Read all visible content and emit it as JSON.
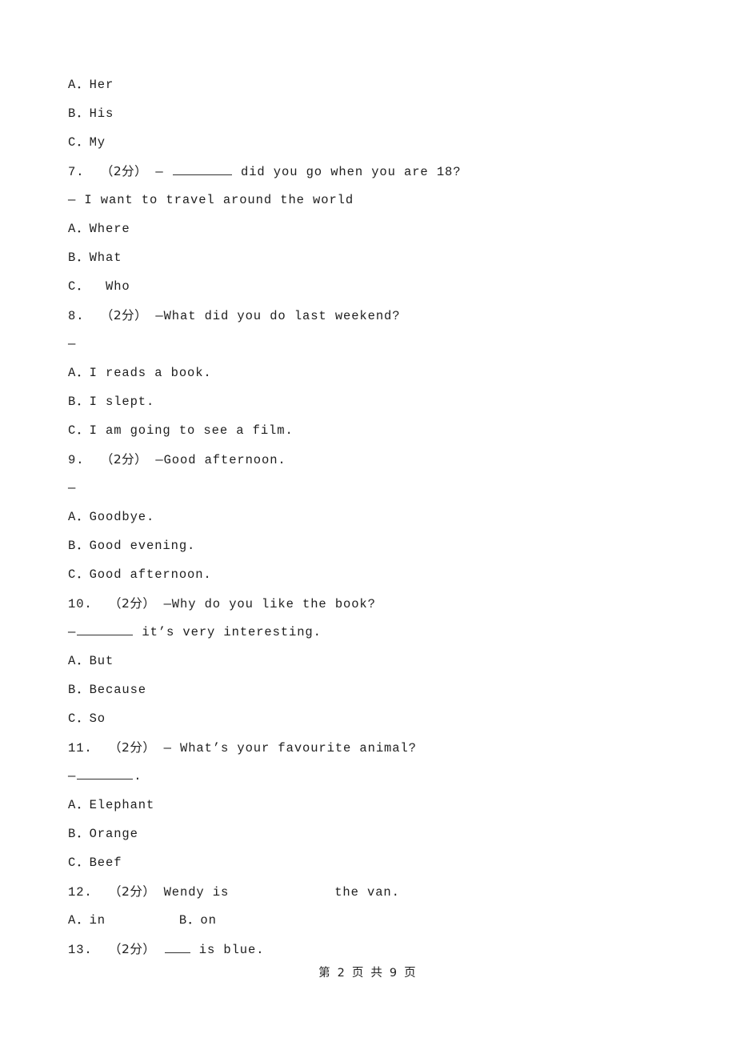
{
  "document": {
    "page_number": 2,
    "total_pages": 9,
    "footer_text": "第 2 页 共 9 页",
    "score_marker": "（2分）",
    "dash_marker": "—"
  },
  "lines": [
    {
      "id": "l1",
      "kind": "option",
      "text": "A．Her"
    },
    {
      "id": "l2",
      "kind": "option",
      "text": "B．His"
    },
    {
      "id": "l3",
      "kind": "option",
      "text": "C．My"
    },
    {
      "id": "l4",
      "kind": "stem",
      "number": "7.",
      "score": "（2分）",
      "pre": "— ",
      "post": " did you go when you are 18?",
      "blank": "long"
    },
    {
      "id": "l5",
      "kind": "answer",
      "text": "— I want to travel around the world"
    },
    {
      "id": "l6",
      "kind": "option",
      "text": "A．Where"
    },
    {
      "id": "l7",
      "kind": "option",
      "text": "B．What"
    },
    {
      "id": "l8",
      "kind": "option",
      "text": "C．  Who"
    },
    {
      "id": "l9",
      "kind": "stem",
      "number": "8.",
      "score": "（2分）",
      "pre": "—What did you do last weekend?",
      "post": "",
      "blank": "none"
    },
    {
      "id": "l10",
      "kind": "dash",
      "text": "—"
    },
    {
      "id": "l11",
      "kind": "option",
      "text": "A．I reads a book."
    },
    {
      "id": "l12",
      "kind": "option",
      "text": "B．I slept."
    },
    {
      "id": "l13",
      "kind": "option",
      "text": "C．I am going to see a film."
    },
    {
      "id": "l14",
      "kind": "stem",
      "number": "9.",
      "score": "（2分）",
      "pre": "—Good afternoon.",
      "post": "",
      "blank": "none"
    },
    {
      "id": "l15",
      "kind": "dash",
      "text": "—"
    },
    {
      "id": "l16",
      "kind": "option",
      "text": "A．Goodbye."
    },
    {
      "id": "l17",
      "kind": "option",
      "text": "B．Good evening."
    },
    {
      "id": "l18",
      "kind": "option",
      "text": "C．Good afternoon."
    },
    {
      "id": "l19",
      "kind": "stem",
      "number": "10.",
      "score": "（2分）",
      "pre": "—Why do you like the book?",
      "post": "",
      "blank": "none"
    },
    {
      "id": "l20",
      "kind": "answer_blank",
      "pre": "—",
      "post": " it’s very interesting.",
      "blank": "mid"
    },
    {
      "id": "l21",
      "kind": "option",
      "text": "A．But"
    },
    {
      "id": "l22",
      "kind": "option",
      "text": "B．Because"
    },
    {
      "id": "l23",
      "kind": "option",
      "text": "C．So"
    },
    {
      "id": "l24",
      "kind": "stem",
      "number": "11.",
      "score": "（2分）",
      "pre": "— What’s your favourite animal?",
      "post": "",
      "blank": "none"
    },
    {
      "id": "l25",
      "kind": "answer_blank",
      "pre": "—",
      "post": ".",
      "blank": "mid"
    },
    {
      "id": "l26",
      "kind": "option",
      "text": "A．Elephant"
    },
    {
      "id": "l27",
      "kind": "option",
      "text": "B．Orange"
    },
    {
      "id": "l28",
      "kind": "option",
      "text": "C．Beef"
    },
    {
      "id": "l29",
      "kind": "stem_gap",
      "number": "12.",
      "score": "（2分）",
      "pre": "Wendy is",
      "post": "the van."
    },
    {
      "id": "l30",
      "kind": "option",
      "text": "A．in         B．on"
    },
    {
      "id": "l31",
      "kind": "stem",
      "number": "13.",
      "score": "（2分）",
      "pre": "",
      "post": " is blue.",
      "blank": "short"
    }
  ],
  "questions": [
    {
      "number": "7.",
      "score": "（2分）",
      "stem": "— ________ did you go when you are 18?",
      "answer_line": "— I want to travel around the world",
      "options": [
        {
          "label": "A．",
          "text": "Where"
        },
        {
          "label": "B．",
          "text": "What"
        },
        {
          "label": "C．",
          "text": "  Who"
        }
      ]
    },
    {
      "number": "8.",
      "score": "（2分）",
      "stem": "—What did you do last weekend?",
      "answer_line": "—",
      "options": [
        {
          "label": "A．",
          "text": "I reads a book."
        },
        {
          "label": "B．",
          "text": "I slept."
        },
        {
          "label": "C．",
          "text": "I am going to see a film."
        }
      ]
    },
    {
      "number": "9.",
      "score": "（2分）",
      "stem": "—Good afternoon.",
      "answer_line": "—",
      "options": [
        {
          "label": "A．",
          "text": "Goodbye."
        },
        {
          "label": "B．",
          "text": "Good evening."
        },
        {
          "label": "C．",
          "text": "Good afternoon."
        }
      ]
    },
    {
      "number": "10.",
      "score": "（2分）",
      "stem": "—Why do you like the book?",
      "answer_line": "—________ it’s very interesting.",
      "options": [
        {
          "label": "A．",
          "text": "But"
        },
        {
          "label": "B．",
          "text": "Because"
        },
        {
          "label": "C．",
          "text": "So"
        }
      ]
    },
    {
      "number": "11.",
      "score": "（2分）",
      "stem": "— What’s your favourite animal?",
      "answer_line": "—________.",
      "options": [
        {
          "label": "A．",
          "text": "Elephant"
        },
        {
          "label": "B．",
          "text": "Orange"
        },
        {
          "label": "C．",
          "text": "Beef"
        }
      ]
    },
    {
      "number": "12.",
      "score": "（2分）",
      "stem": "Wendy is            the van.",
      "answer_line": "",
      "options": [
        {
          "label": "A．",
          "text": "in"
        },
        {
          "label": "B．",
          "text": "on"
        }
      ]
    },
    {
      "number": "13.",
      "score": "（2分）",
      "stem": "___ is blue.",
      "answer_line": "",
      "options": []
    }
  ],
  "partial_question_6_options": [
    {
      "label": "A．",
      "text": "Her"
    },
    {
      "label": "B．",
      "text": "His"
    },
    {
      "label": "C．",
      "text": "My"
    }
  ]
}
